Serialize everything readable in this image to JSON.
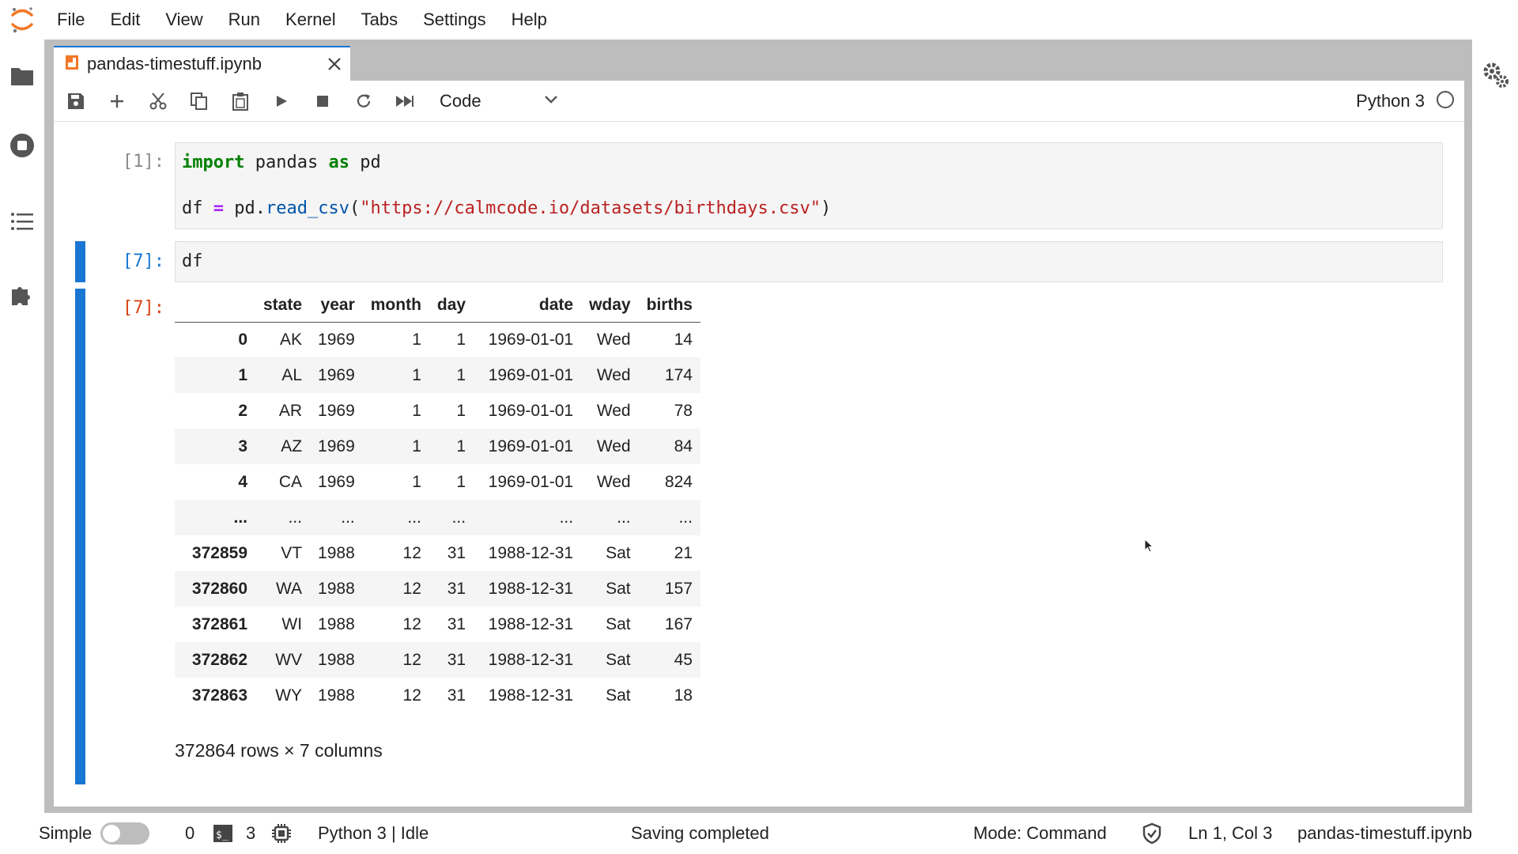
{
  "menubar": {
    "items": [
      "File",
      "Edit",
      "View",
      "Run",
      "Kernel",
      "Tabs",
      "Settings",
      "Help"
    ]
  },
  "icons": {
    "logo": "jupyter-logo-icon",
    "left_sidebar": [
      "folder-icon",
      "running-stop-icon",
      "table-of-contents-icon",
      "extension-puzzle-icon"
    ],
    "right_sidebar": [
      "property-inspector-gears-icon"
    ],
    "toolbar": [
      "save-icon",
      "add-cell-icon",
      "cut-icon",
      "copy-icon",
      "paste-icon",
      "run-icon",
      "stop-icon",
      "restart-icon",
      "run-all-icon"
    ]
  },
  "tab": {
    "label": "pandas-timestuff.ipynb"
  },
  "toolbar": {
    "cell_type": "Code",
    "kernel_name": "Python 3"
  },
  "cells": [
    {
      "prompt": "[1]:",
      "code_line1": {
        "kw1": "import",
        "mod": " pandas ",
        "kw2": "as",
        "alias": " pd"
      },
      "code_line2": {
        "var": "df ",
        "eq": "=",
        "obj": " pd.",
        "fn": "read_csv",
        "open": "(",
        "str": "\"https://calmcode.io/datasets/birthdays.csv\"",
        "close": ")"
      }
    },
    {
      "prompt": "[7]:",
      "code": "df"
    }
  ],
  "output": {
    "prompt": "[7]:",
    "columns": [
      "state",
      "year",
      "month",
      "day",
      "date",
      "wday",
      "births"
    ],
    "rows": [
      [
        "0",
        "AK",
        "1969",
        "1",
        "1",
        "1969-01-01",
        "Wed",
        "14"
      ],
      [
        "1",
        "AL",
        "1969",
        "1",
        "1",
        "1969-01-01",
        "Wed",
        "174"
      ],
      [
        "2",
        "AR",
        "1969",
        "1",
        "1",
        "1969-01-01",
        "Wed",
        "78"
      ],
      [
        "3",
        "AZ",
        "1969",
        "1",
        "1",
        "1969-01-01",
        "Wed",
        "84"
      ],
      [
        "4",
        "CA",
        "1969",
        "1",
        "1",
        "1969-01-01",
        "Wed",
        "824"
      ],
      [
        "...",
        "...",
        "...",
        "...",
        "...",
        "...",
        "...",
        "..."
      ],
      [
        "372859",
        "VT",
        "1988",
        "12",
        "31",
        "1988-12-31",
        "Sat",
        "21"
      ],
      [
        "372860",
        "WA",
        "1988",
        "12",
        "31",
        "1988-12-31",
        "Sat",
        "157"
      ],
      [
        "372861",
        "WI",
        "1988",
        "12",
        "31",
        "1988-12-31",
        "Sat",
        "167"
      ],
      [
        "372862",
        "WV",
        "1988",
        "12",
        "31",
        "1988-12-31",
        "Sat",
        "45"
      ],
      [
        "372863",
        "WY",
        "1988",
        "12",
        "31",
        "1988-12-31",
        "Sat",
        "18"
      ]
    ],
    "shape": "372864 rows × 7 columns"
  },
  "statusbar": {
    "mode_simple": "Simple",
    "terminals": "0",
    "kernels": "3",
    "kernel_status": "Python 3 | Idle",
    "message": "Saving completed",
    "mode": "Mode: Command",
    "position": "Ln 1, Col 3",
    "filename": "pandas-timestuff.ipynb"
  },
  "colors": {
    "accent": "#1976d2",
    "out_prompt": "#d84315",
    "logo": "#f37726"
  }
}
